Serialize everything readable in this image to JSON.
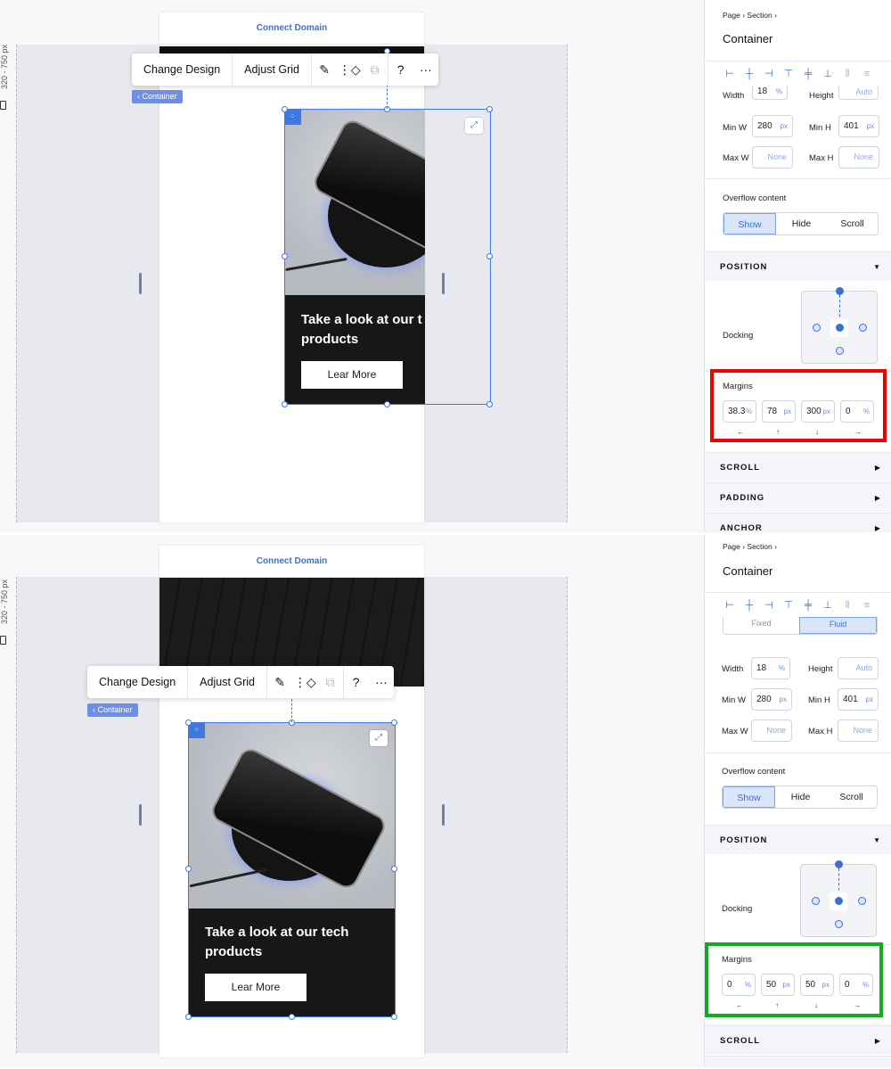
{
  "canvas": {
    "ruler_label": "320 - 750 px",
    "connect_domain": "Connect Domain"
  },
  "toolbar": {
    "change_design": "Change Design",
    "adjust_grid": "Adjust Grid",
    "help": "?",
    "more": "···"
  },
  "container_tag": "‹ Container",
  "card": {
    "title_a_line1": "Take a look at our t",
    "title_a_line2": "products",
    "title_b_line1": "Take a look at our tech",
    "title_b_line2": "products",
    "button": "Lear More"
  },
  "panel": {
    "breadcrumb": "Page  ›  Section  ›",
    "title": "Container",
    "size_mode_a": "Fixed",
    "size_mode_b": "Fluid",
    "width_label": "Width",
    "width_value": "18",
    "width_unit": "%",
    "height_label": "Height",
    "height_value": "Auto",
    "min_w_label": "Min W",
    "min_w_value": "280",
    "min_w_unit": "px",
    "min_h_label": "Min H",
    "min_h_value": "401",
    "min_h_unit": "px",
    "max_w_label": "Max W",
    "max_w_value": "None",
    "max_h_label": "Max H",
    "max_h_value": "None",
    "overflow_label": "Overflow content",
    "overflow_show": "Show",
    "overflow_hide": "Hide",
    "overflow_scroll": "Scroll",
    "position_head": "POSITION",
    "docking_label": "Docking",
    "margins_label": "Margins",
    "scroll_head": "SCROLL",
    "padding_head": "PADDING",
    "anchor_head": "ANCHOR"
  },
  "margins_before": {
    "left": "38.3",
    "left_unit": "%",
    "top": "78",
    "top_unit": "px",
    "bottom": "300",
    "bottom_unit": "px",
    "right": "0",
    "right_unit": "%"
  },
  "margins_after": {
    "left": "0",
    "left_unit": "%",
    "top": "50",
    "top_unit": "px",
    "bottom": "50",
    "bottom_unit": "px",
    "right": "0",
    "right_unit": "%"
  },
  "margin_arrows": [
    "←",
    "↑",
    "↓",
    "→"
  ],
  "colors": {
    "highlight_before": "#ef0000",
    "highlight_after": "#16a822",
    "accent": "#3b6fd4"
  }
}
